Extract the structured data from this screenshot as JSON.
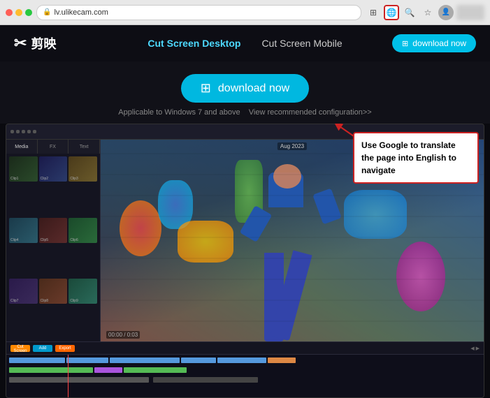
{
  "browser": {
    "url": "lv.ulikecam.com",
    "tabs": []
  },
  "nav": {
    "logo_text": "剪映",
    "links": [
      {
        "label": "Cut Screen Desktop",
        "active": true
      },
      {
        "label": "Cut Screen Mobile",
        "active": false
      }
    ],
    "download_label": "download now"
  },
  "hero": {
    "download_label": "download now",
    "subtitle1": "Applicable to Windows 7 and above",
    "subtitle2": "View recommended configuration>>"
  },
  "annotation": {
    "text": "Use Google to translate the page into English to navigate"
  },
  "timeline": {
    "btn1": "Cut Screen",
    "btn2": "Add",
    "btn3": "Export"
  }
}
